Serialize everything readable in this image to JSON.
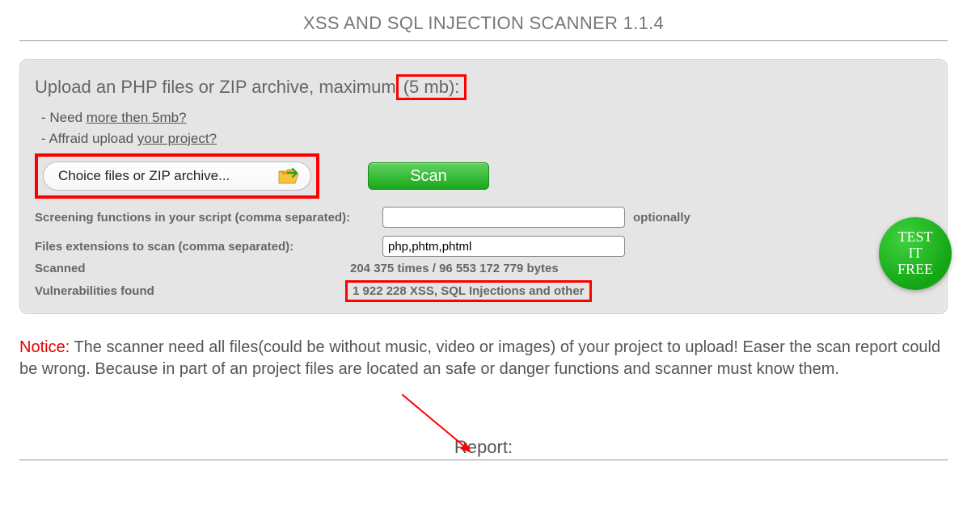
{
  "title": "XSS AND SQL INJECTION SCANNER 1.1.4",
  "panel": {
    "heading_prefix": "Upload an PHP files or ZIP archive, maximum",
    "heading_boxed": " (5 mb):",
    "note1_prefix": "- Need ",
    "note1_link": "more then 5mb?",
    "note2_prefix": "- Affraid upload ",
    "note2_link": "your project?",
    "upload_label": "Choice files or ZIP archive...",
    "scan_label": "Scan",
    "screening_label": "Screening functions in your script (comma separated):",
    "screening_after": "optionally",
    "ext_label": "Files extensions to scan (comma separated):",
    "ext_value": "php,phtm,phtml",
    "scanned_label": "Scanned",
    "scanned_value": "204 375 times / 96 553 172 779 bytes",
    "vuln_label": "Vulnerabilities found",
    "vuln_value": "1 922 228 XSS, SQL Injections and other"
  },
  "badge": {
    "line1": "TEST",
    "line2": "IT",
    "line3": "FREE"
  },
  "notice": {
    "label": "Notice:",
    "text": " The scanner need all files(could be without music, video or images) of your project to upload! Easer the scan report could be wrong. Because in part of an project files are located an safe or danger functions and scanner must know them."
  },
  "report_label": "Report:"
}
